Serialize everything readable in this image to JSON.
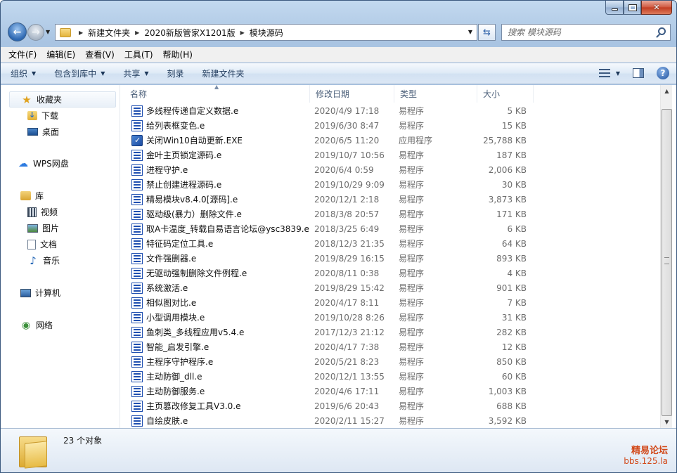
{
  "window": {
    "controls": {
      "minimize": "–",
      "maximize": "□",
      "close": "✕"
    }
  },
  "navbar": {
    "breadcrumbs": [
      "新建文件夹",
      "2020新版管家X1201版",
      "模块源码"
    ],
    "search_placeholder": "搜索 模块源码"
  },
  "menubar": [
    "文件(F)",
    "编辑(E)",
    "查看(V)",
    "工具(T)",
    "帮助(H)"
  ],
  "commandbar": {
    "organize": "组织",
    "include_library": "包含到库中",
    "share": "共享",
    "burn": "刻录",
    "new_folder": "新建文件夹"
  },
  "sidebar": {
    "favorites": {
      "label": "收藏夹",
      "items": [
        "下载",
        "桌面"
      ]
    },
    "wps": "WPS网盘",
    "libraries": {
      "label": "库",
      "items": [
        "视频",
        "图片",
        "文档",
        "音乐"
      ]
    },
    "computer": "计算机",
    "network": "网络"
  },
  "columns": {
    "name": "名称",
    "date": "修改日期",
    "type": "类型",
    "size": "大小"
  },
  "files": [
    {
      "name": "多线程传递自定义数据.e",
      "date": "2020/4/9 17:18",
      "type": "易程序",
      "size": "5 KB",
      "icon": "e-file-icon"
    },
    {
      "name": "给列表框变色.e",
      "date": "2019/6/30 8:47",
      "type": "易程序",
      "size": "15 KB",
      "icon": "e-file-icon"
    },
    {
      "name": "关闭Win10自动更新.EXE",
      "date": "2020/6/5 11:20",
      "type": "应用程序",
      "size": "25,788 KB",
      "icon": "exe-icon"
    },
    {
      "name": "金叶主页锁定源码.e",
      "date": "2019/10/7 10:56",
      "type": "易程序",
      "size": "187 KB",
      "icon": "e-file-icon"
    },
    {
      "name": "进程守护.e",
      "date": "2020/6/4 0:59",
      "type": "易程序",
      "size": "2,006 KB",
      "icon": "e-file-icon"
    },
    {
      "name": "禁止创建进程源码.e",
      "date": "2019/10/29 9:09",
      "type": "易程序",
      "size": "30 KB",
      "icon": "e-file-icon"
    },
    {
      "name": "精易模块v8.4.0[源码].e",
      "date": "2020/12/1 2:18",
      "type": "易程序",
      "size": "3,873 KB",
      "icon": "e-file-icon"
    },
    {
      "name": "驱动级(暴力）删除文件.e",
      "date": "2018/3/8 20:57",
      "type": "易程序",
      "size": "171 KB",
      "icon": "e-file-icon"
    },
    {
      "name": "取A卡温度_转载自易语言论坛@ysc3839.e",
      "date": "2018/3/25 6:49",
      "type": "易程序",
      "size": "6 KB",
      "icon": "e-file-icon"
    },
    {
      "name": "特征码定位工具.e",
      "date": "2018/12/3 21:35",
      "type": "易程序",
      "size": "64 KB",
      "icon": "e-file-icon"
    },
    {
      "name": "文件强删器.e",
      "date": "2019/8/29 16:15",
      "type": "易程序",
      "size": "893 KB",
      "icon": "e-file-icon"
    },
    {
      "name": "无驱动强制删除文件例程.e",
      "date": "2020/8/11 0:38",
      "type": "易程序",
      "size": "4 KB",
      "icon": "e-file-icon"
    },
    {
      "name": "系统激活.e",
      "date": "2019/8/29 15:42",
      "type": "易程序",
      "size": "901 KB",
      "icon": "e-file-icon"
    },
    {
      "name": "相似图对比.e",
      "date": "2020/4/17 8:11",
      "type": "易程序",
      "size": "7 KB",
      "icon": "e-file-icon"
    },
    {
      "name": "小型调用模块.e",
      "date": "2019/10/28 8:26",
      "type": "易程序",
      "size": "31 KB",
      "icon": "e-file-icon"
    },
    {
      "name": "鱼刺类_多线程应用v5.4.e",
      "date": "2017/12/3 21:12",
      "type": "易程序",
      "size": "282 KB",
      "icon": "e-file-icon"
    },
    {
      "name": "智能_启发引擎.e",
      "date": "2020/4/17 7:38",
      "type": "易程序",
      "size": "12 KB",
      "icon": "e-file-icon"
    },
    {
      "name": "主程序守护程序.e",
      "date": "2020/5/21 8:23",
      "type": "易程序",
      "size": "850 KB",
      "icon": "e-file-icon"
    },
    {
      "name": "主动防御_dll.e",
      "date": "2020/12/1 13:55",
      "type": "易程序",
      "size": "60 KB",
      "icon": "e-file-icon"
    },
    {
      "name": "主动防御服务.e",
      "date": "2020/4/6 17:11",
      "type": "易程序",
      "size": "1,003 KB",
      "icon": "e-file-icon"
    },
    {
      "name": "主页篡改修复工具V3.0.e",
      "date": "2019/6/6 20:43",
      "type": "易程序",
      "size": "688 KB",
      "icon": "e-file-icon"
    },
    {
      "name": "自绘皮肤.e",
      "date": "2020/2/11 15:27",
      "type": "易程序",
      "size": "3,592 KB",
      "icon": "e-file-icon"
    }
  ],
  "details": {
    "count": "23 个对象"
  },
  "watermark": {
    "line1": "精易论坛",
    "line2": "bbs.125.la"
  },
  "colors": {
    "accent": "#1e395b",
    "watermark": "#d2491a",
    "file_icon": "#1f4fb0"
  }
}
